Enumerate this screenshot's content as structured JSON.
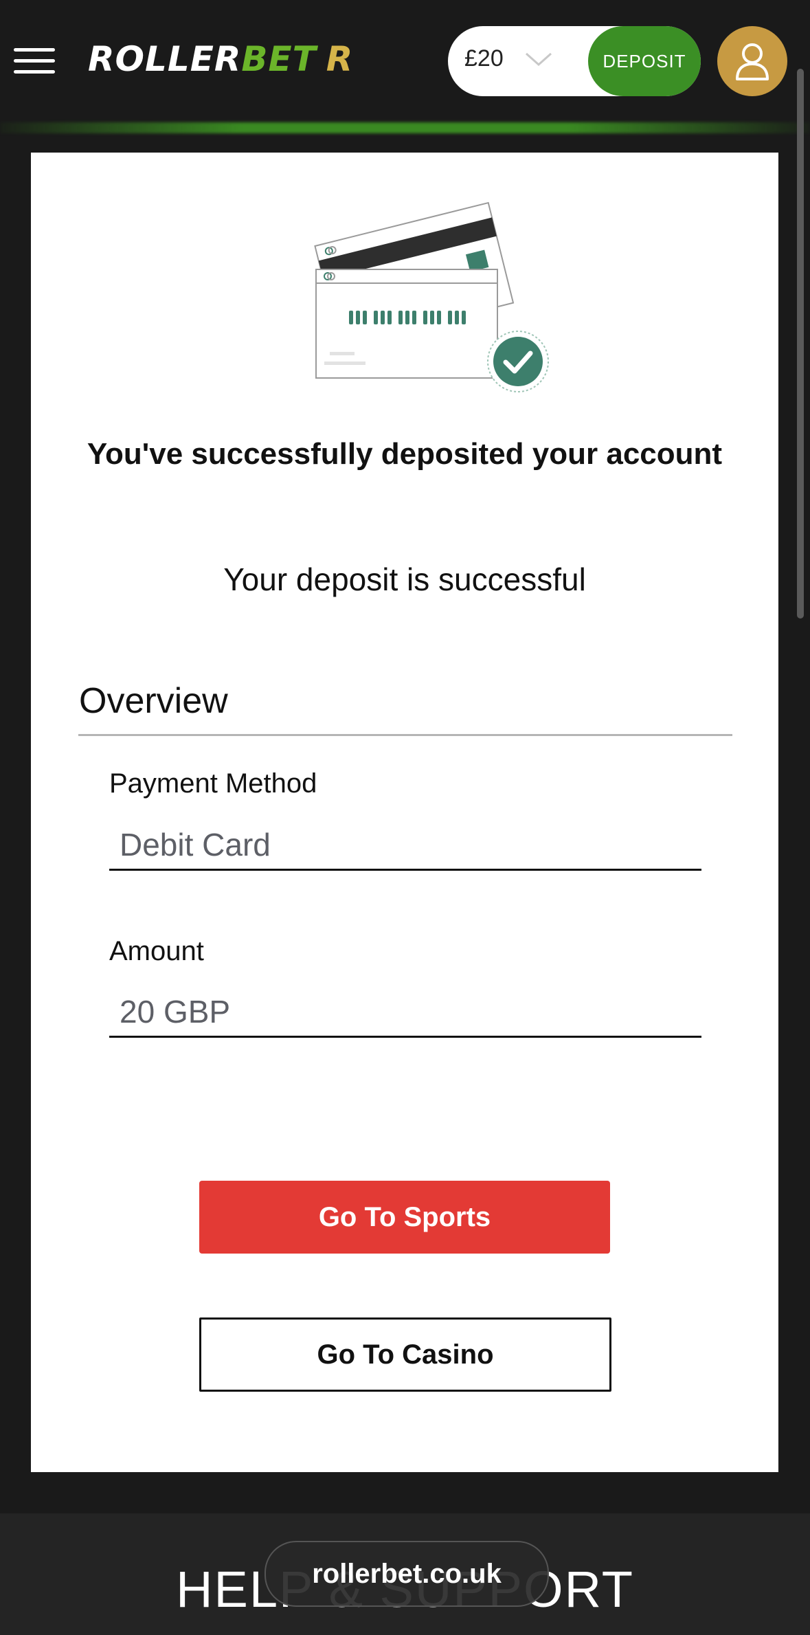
{
  "header": {
    "balance": "£20",
    "deposit_label": "DEPOSIT",
    "logo": {
      "part1": "ROLLER",
      "part2": "BET",
      "part3": "R"
    }
  },
  "card": {
    "title": "You've successfully deposited your account",
    "subtitle": "Your deposit is successful",
    "overview_heading": "Overview",
    "fields": [
      {
        "label": "Payment Method",
        "value": "Debit Card"
      },
      {
        "label": "Amount",
        "value": "20 GBP"
      }
    ],
    "sports_button": "Go To Sports",
    "casino_button": "Go To Casino"
  },
  "footer": {
    "help_text": "HELP & SUPPORT",
    "url": "rollerbet.co.uk"
  },
  "colors": {
    "brand_green": "#3b8f25",
    "logo_green": "#6bb52a",
    "gold": "#c79a42",
    "sports_red": "#e33a35",
    "success_teal": "#3d7f6c"
  }
}
